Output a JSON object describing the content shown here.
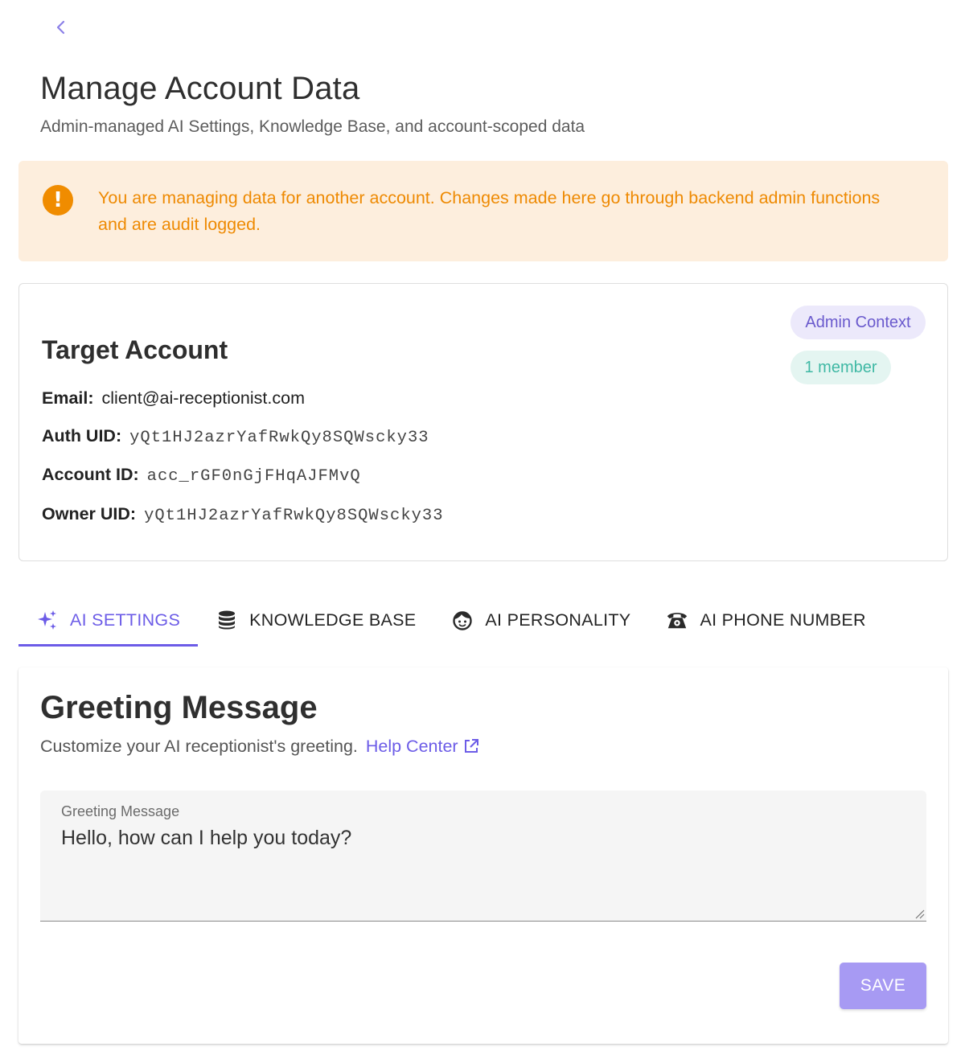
{
  "header": {
    "title": "Manage Account Data",
    "subtitle": "Admin-managed AI Settings, Knowledge Base, and account-scoped data"
  },
  "alert": {
    "text": "You are managing data for another account. Changes made here go through backend admin functions and are audit logged.",
    "icon": "warning-icon",
    "color": "#ee8a03"
  },
  "account": {
    "title": "Target Account",
    "chips": {
      "context": "Admin Context",
      "members": "1 member"
    },
    "fields": [
      {
        "label": "Email:",
        "value": "client@ai-receptionist.com"
      },
      {
        "label": "Auth UID:",
        "value": "yQt1HJ2azrYafRwkQy8SQWscky33"
      },
      {
        "label": "Account ID:",
        "value": "acc_rGF0nGjFHqAJFMvQ"
      },
      {
        "label": "Owner UID:",
        "value": "yQt1HJ2azrYafRwkQy8SQWscky33"
      }
    ]
  },
  "tabs": [
    {
      "label": "AI SETTINGS",
      "icon": "sparkles-icon",
      "active": true
    },
    {
      "label": "KNOWLEDGE BASE",
      "icon": "database-icon",
      "active": false
    },
    {
      "label": "AI PERSONALITY",
      "icon": "face-icon",
      "active": false
    },
    {
      "label": "AI PHONE NUMBER",
      "icon": "phone-icon",
      "active": false
    }
  ],
  "greeting": {
    "title": "Greeting Message",
    "description": "Customize your AI receptionist's greeting.",
    "help_link": "Help Center",
    "field_label": "Greeting Message",
    "field_value": "Hello, how can I help you today?",
    "save_label": "SAVE"
  },
  "colors": {
    "accent": "#6c5ce7",
    "warning": "#f08c00",
    "alert_bg": "#fdeedd"
  }
}
